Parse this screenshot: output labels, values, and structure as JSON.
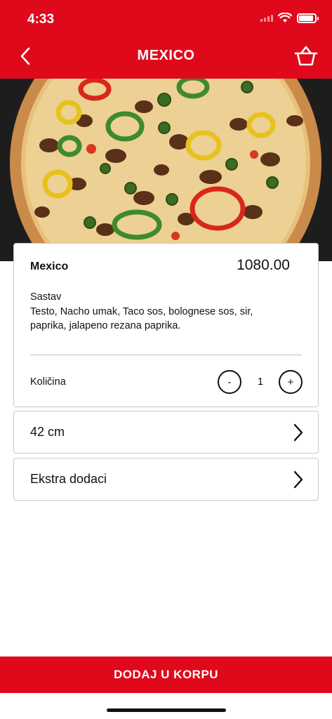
{
  "status_bar": {
    "time": "4:33"
  },
  "nav": {
    "title": "MEXICO",
    "back_icon": "chevron-left-icon",
    "cart_icon": "basket-icon"
  },
  "hero": {
    "image": "pizza-photo"
  },
  "product": {
    "name": "Mexico",
    "price": "1080.00",
    "ingredients_label": "Sastav",
    "ingredients": "Testo, Nacho umak, Taco sos, bolognese sos, sir, paprika, jalapeno rezana paprika."
  },
  "quantity": {
    "label": "Količina",
    "minus": "-",
    "value": "1",
    "plus": "+"
  },
  "options": {
    "size_label": "42 cm",
    "extras_label": "Ekstra dodaci"
  },
  "actions": {
    "add_to_cart": "DODAJ U KORPU"
  },
  "colors": {
    "brand_red": "#e0091b"
  }
}
